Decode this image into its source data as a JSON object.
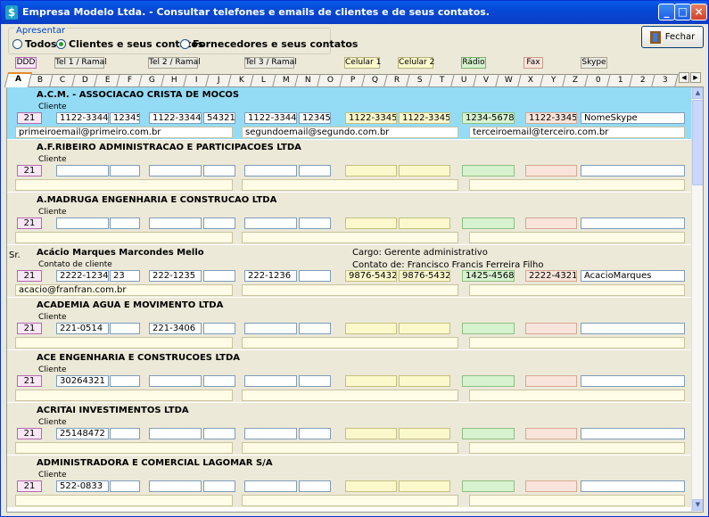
{
  "window": {
    "title": "Empresa Modelo Ltda. - Consultar telefones e emails de clientes e de seus contatos."
  },
  "filter": {
    "legend": "Apresentar",
    "options": [
      "Todos",
      "Clientes e seus contatos",
      "Fornecedores e seus contatos"
    ],
    "selected_index": 1
  },
  "close_button": "Fechar",
  "headers": {
    "ddd": "DDD",
    "tel1": "Tel 1 / Ramal",
    "tel2": "Tel 2 / Ramal",
    "tel3": "Tel 3 / Ramal",
    "cel1": "Celular 1",
    "cel2": "Celular 2",
    "radio": "Rádio",
    "fax": "Fax",
    "skype": "Skype"
  },
  "tabs": [
    "A",
    "B",
    "C",
    "D",
    "E",
    "F",
    "G",
    "H",
    "I",
    "J",
    "K",
    "L",
    "M",
    "N",
    "O",
    "P",
    "Q",
    "R",
    "S",
    "T",
    "U",
    "V",
    "W",
    "X",
    "Y",
    "Z",
    "0",
    "1",
    "2",
    "3"
  ],
  "active_tab": "A",
  "records": [
    {
      "name": "A.C.M. - ASSOCIACAO CRISTA DE MOCOS",
      "kind": "Cliente",
      "selected": true,
      "ddd": "21",
      "tel1": "1122-3344",
      "ramal1": "12345",
      "tel2": "1122-3344",
      "ramal2": "54321",
      "tel3": "1122-3344",
      "ramal3": "12345",
      "cel1": "1122-3345",
      "cel2": "1122-3345",
      "radio": "1234-5678",
      "fax": "1122-3345",
      "skype": "NomeSkype",
      "email1": "primeiroemail@primeiro.com.br",
      "email2": "segundoemail@segundo.com.br",
      "email3": "terceiroemail@terceiro.com.br"
    },
    {
      "name": "A.F.RIBEIRO ADMINISTRACAO E PARTICIPACOES LTDA",
      "kind": "Cliente",
      "ddd": "21"
    },
    {
      "name": "A.MADRUGA ENGENHARIA E CONSTRUCAO LTDA",
      "kind": "Cliente",
      "ddd": "21"
    },
    {
      "name": "Acácio Marques Marcondes Mello",
      "kind": "Contato de cliente",
      "treatment": "Sr.",
      "cargo": "Cargo: Gerente administrativo",
      "contato_de": "Contato de: Francisco Francis Ferreira Filho",
      "ddd": "21",
      "tel1": "2222-1234",
      "ramal1": "23",
      "tel2": "222-1235",
      "tel3": "222-1236",
      "cel1": "9876-5432",
      "cel2": "9876-5432",
      "radio": "1425-4568",
      "fax": "2222-4321",
      "skype": "AcacioMarques",
      "email1": "acacio@franfran.com.br"
    },
    {
      "name": "ACADEMIA AGUA E MOVIMENTO LTDA",
      "kind": "Cliente",
      "ddd": "21",
      "tel1": "221-0514",
      "tel2": "221-3406"
    },
    {
      "name": "ACE ENGENHARIA E CONSTRUCOES LTDA",
      "kind": "Cliente",
      "ddd": "21",
      "tel1": "30264321"
    },
    {
      "name": "ACRITAI INVESTIMENTOS LTDA",
      "kind": "Cliente",
      "ddd": "21",
      "tel1": "25148472"
    },
    {
      "name": "ADMINISTRADORA E COMERCIAL LAGOMAR S/A",
      "kind": "Cliente",
      "ddd": "21",
      "tel1": "522-0833"
    }
  ]
}
